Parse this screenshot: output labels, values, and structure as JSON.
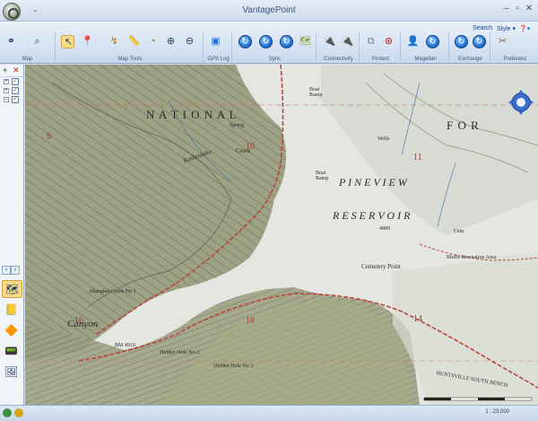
{
  "window": {
    "title": "VantagePoint",
    "qat": "⌄"
  },
  "ribbon": {
    "search_label": "Search",
    "style_label": "Style",
    "groups": [
      {
        "label": "Map"
      },
      {
        "label": "Map Tools"
      },
      {
        "label": "GPS Log"
      },
      {
        "label": "Sync"
      },
      {
        "label": "Connectivity"
      },
      {
        "label": "Protect"
      },
      {
        "label": "Magellan"
      },
      {
        "label": "Exchange"
      },
      {
        "label": "Preferenc"
      }
    ]
  },
  "map": {
    "labels": {
      "national": "N A T I O N A L",
      "forest": "F O R",
      "pineview": "P I N E V I E W",
      "reservoir": "R E S E R V O I R",
      "rattlesnake": "Rattlesnake",
      "creek": "Creek",
      "spring": "Spring",
      "boat_ramp_1": "Boat Ramp",
      "boat_ramp_2": "Boat Ramp",
      "wells": "Wells",
      "cem": "Cem",
      "cemetery_point": "Cemetery Point",
      "bluffs": "Bluffs Recreation Area",
      "shanghai_creek": "Shanghai Creek No 1",
      "canyon": "Canyon",
      "section_9": "9",
      "section_10": "10",
      "section_11": "11",
      "section_14": "14",
      "section_16": "16",
      "section_18": "18",
      "huntsville": "HUNTSVILLE  SOUTH  BENCH",
      "hidden_hole": "Hidden Hole No 2",
      "hidden_hole_3": "Hidden Hole No 3",
      "bm": "BM 4919",
      "elev": "4889"
    }
  },
  "status": {
    "scale": "1 : 23,000"
  },
  "colors": {
    "accent": "#1d6fd1",
    "selection": "#f9dc8a",
    "road": "#b8473c",
    "water": "#e4e6e1"
  }
}
